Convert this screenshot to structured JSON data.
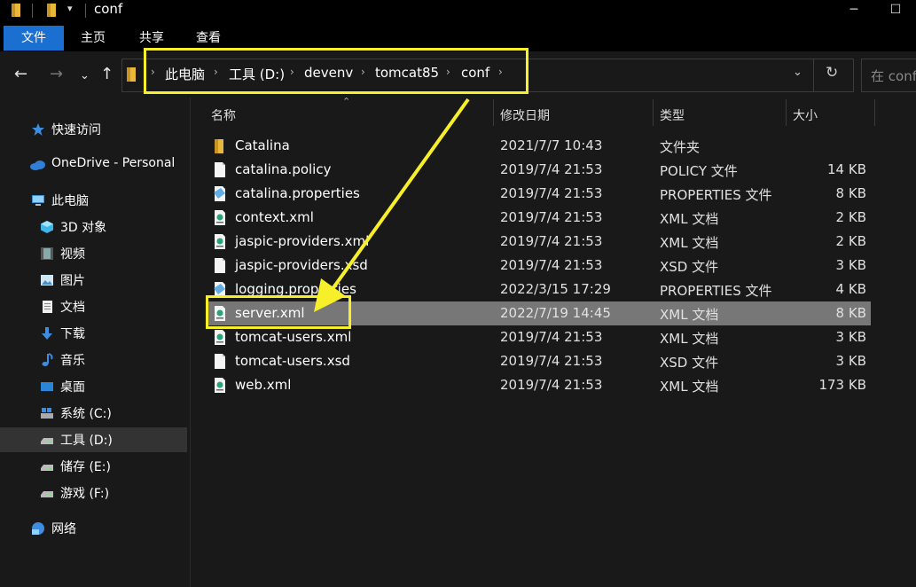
{
  "window": {
    "title": "conf"
  },
  "ribbon": {
    "tabs": [
      "文件",
      "主页",
      "共享",
      "查看"
    ]
  },
  "address": {
    "crumbs": [
      "此电脑",
      "工具 (D:)",
      "devenv",
      "tomcat85",
      "conf"
    ],
    "search_placeholder": "在 conf"
  },
  "sidebar": {
    "items": [
      {
        "label": "快速访问",
        "icon": "star-icon"
      },
      {
        "label": "OneDrive - Personal",
        "icon": "cloud-icon"
      },
      {
        "label": "此电脑",
        "icon": "computer-icon"
      },
      {
        "label": "3D 对象",
        "icon": "cube-icon"
      },
      {
        "label": "视频",
        "icon": "video-icon"
      },
      {
        "label": "图片",
        "icon": "picture-icon"
      },
      {
        "label": "文档",
        "icon": "document-icon"
      },
      {
        "label": "下载",
        "icon": "download-icon"
      },
      {
        "label": "音乐",
        "icon": "music-icon"
      },
      {
        "label": "桌面",
        "icon": "desktop-icon"
      },
      {
        "label": "系统 (C:)",
        "icon": "system-drive-icon"
      },
      {
        "label": "工具 (D:)",
        "icon": "drive-icon"
      },
      {
        "label": "储存 (E:)",
        "icon": "drive-icon"
      },
      {
        "label": "游戏 (F:)",
        "icon": "drive-icon"
      },
      {
        "label": "网络",
        "icon": "network-icon"
      }
    ]
  },
  "columns": {
    "name": "名称",
    "modified": "修改日期",
    "type": "类型",
    "size": "大小"
  },
  "files": [
    {
      "name": "Catalina",
      "modified": "2021/7/7 10:43",
      "type": "文件夹",
      "size": "",
      "icon": "folder-icon"
    },
    {
      "name": "catalina.policy",
      "modified": "2019/7/4 21:53",
      "type": "POLICY 文件",
      "size": "14 KB",
      "icon": "file-icon"
    },
    {
      "name": "catalina.properties",
      "modified": "2019/7/4 21:53",
      "type": "PROPERTIES 文件",
      "size": "8 KB",
      "icon": "properties-icon"
    },
    {
      "name": "context.xml",
      "modified": "2019/7/4 21:53",
      "type": "XML 文档",
      "size": "2 KB",
      "icon": "xml-icon"
    },
    {
      "name": "jaspic-providers.xml",
      "modified": "2019/7/4 21:53",
      "type": "XML 文档",
      "size": "2 KB",
      "icon": "xml-icon"
    },
    {
      "name": "jaspic-providers.xsd",
      "modified": "2019/7/4 21:53",
      "type": "XSD 文件",
      "size": "3 KB",
      "icon": "file-icon"
    },
    {
      "name": "logging.properties",
      "modified": "2022/3/15 17:29",
      "type": "PROPERTIES 文件",
      "size": "4 KB",
      "icon": "properties-icon"
    },
    {
      "name": "server.xml",
      "modified": "2022/7/19 14:45",
      "type": "XML 文档",
      "size": "8 KB",
      "icon": "xml-icon"
    },
    {
      "name": "tomcat-users.xml",
      "modified": "2019/7/4 21:53",
      "type": "XML 文档",
      "size": "3 KB",
      "icon": "xml-icon"
    },
    {
      "name": "tomcat-users.xsd",
      "modified": "2019/7/4 21:53",
      "type": "XSD 文件",
      "size": "3 KB",
      "icon": "file-icon"
    },
    {
      "name": "web.xml",
      "modified": "2019/7/4 21:53",
      "type": "XML 文档",
      "size": "173 KB",
      "icon": "xml-icon"
    }
  ],
  "colors": {
    "accent": "#1a6fd0",
    "annotation": "#f7ef2a",
    "selected_row": "#777777"
  }
}
